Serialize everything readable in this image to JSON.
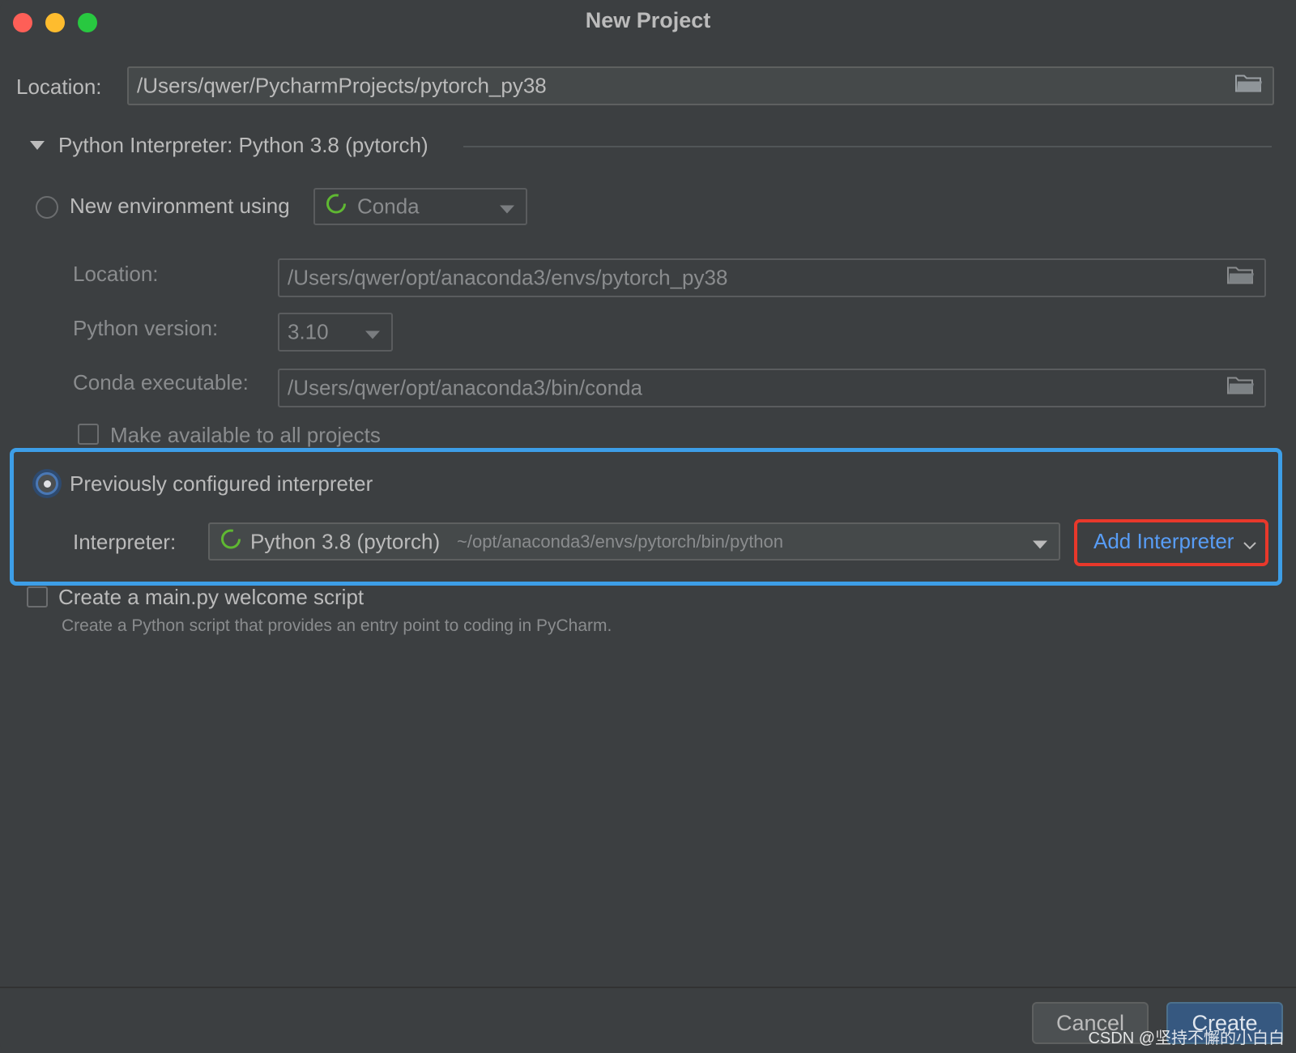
{
  "window": {
    "title": "New Project"
  },
  "project": {
    "location_label": "Location:",
    "location_value": "/Users/qwer/PycharmProjects/pytorch_py38"
  },
  "interpreter_section": {
    "title": "Python Interpreter: Python 3.8 (pytorch)"
  },
  "new_env": {
    "radio_label": "New environment using",
    "tool_value": "Conda",
    "location_label": "Location:",
    "location_value": "/Users/qwer/opt/anaconda3/envs/pytorch_py38",
    "python_version_label": "Python version:",
    "python_version_value": "3.10",
    "conda_exec_label": "Conda executable:",
    "conda_exec_value": "/Users/qwer/opt/anaconda3/bin/conda",
    "make_available_label": "Make available to all projects"
  },
  "previous": {
    "radio_label": "Previously configured interpreter",
    "interpreter_label": "Interpreter:",
    "interpreter_name": "Python 3.8 (pytorch)",
    "interpreter_path": "~/opt/anaconda3/envs/pytorch/bin/python",
    "add_interpreter_label": "Add Interpreter"
  },
  "welcome": {
    "checkbox_label": "Create a main.py welcome script",
    "description": "Create a Python script that provides an entry point to coding in PyCharm."
  },
  "buttons": {
    "cancel": "Cancel",
    "create": "Create"
  },
  "watermark": "CSDN @坚持不懈的小白白",
  "icons": {
    "folder": "folder-icon",
    "conda": "conda-icon",
    "chevron": "chevron-down-icon",
    "triangle": "triangle-down-icon"
  },
  "colors": {
    "background": "#3c3f41",
    "accent_blue_highlight": "#3d9ee7",
    "red_highlight": "#e8382b",
    "link_blue": "#589df6",
    "conda_green": "#5fb832"
  }
}
